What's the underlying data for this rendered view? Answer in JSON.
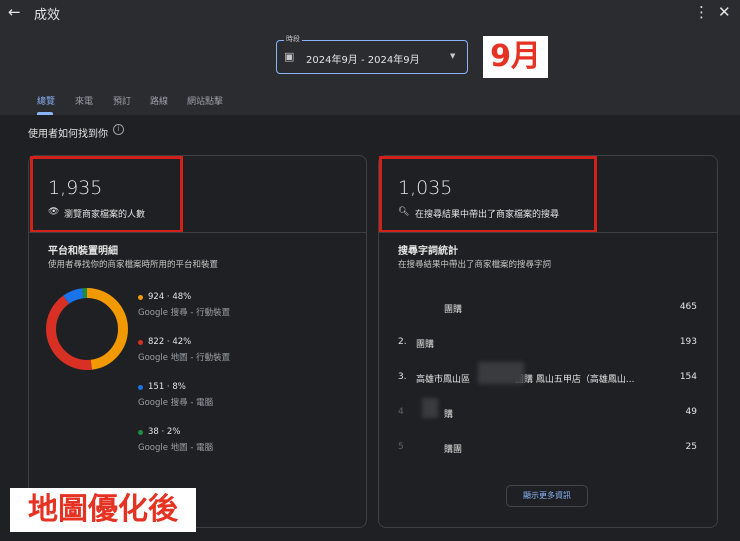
{
  "header": {
    "title": "成效",
    "back_icon": "arrow-left",
    "more_icon": "more-vert",
    "close_icon": "close"
  },
  "date": {
    "label": "時段",
    "value": "2024年9月 - 2024年9月"
  },
  "annotation_month": "9月",
  "annotation_after": "地圖優化後",
  "tabs": [
    {
      "label": "總覽",
      "active": true
    },
    {
      "label": "來電"
    },
    {
      "label": "預訂"
    },
    {
      "label": "路線"
    },
    {
      "label": "網站點擊"
    }
  ],
  "section_title": "使用者如何找到你",
  "left": {
    "count": "1,935",
    "count_label": "瀏覽商家檔案的人數",
    "title": "平台和裝置明細",
    "desc": "使用者尋找你的商家檔案時所用的平台和裝置",
    "legend": [
      {
        "value": "924 · 48%",
        "label": "Google 搜尋 - 行動裝置",
        "color": "#f29900",
        "pct": 48
      },
      {
        "value": "822 · 42%",
        "label": "Google 地圖 - 行動裝置",
        "color": "#d93025",
        "pct": 42
      },
      {
        "value": "151 · 8%",
        "label": "Google 搜尋 - 電腦",
        "color": "#1a73e8",
        "pct": 8
      },
      {
        "value": "38 · 2%",
        "label": "Google 地圖 - 電腦",
        "color": "#1e8e3e",
        "pct": 2
      }
    ]
  },
  "right": {
    "count": "1,035",
    "count_label": "在搜尋結果中帶出了商家檔案的搜尋",
    "title": "搜尋字詞統計",
    "desc": "在搜尋結果中帶出了商家檔案的搜尋字詞",
    "terms": [
      {
        "rank": "",
        "term": "團購",
        "count": "465"
      },
      {
        "rank": "2.",
        "term": "團購",
        "count": "193"
      },
      {
        "rank": "3.",
        "term": "高雄市鳳山區　　　　　團購 鳳山五甲店（高雄鳳山...",
        "count": "154"
      },
      {
        "rank": "4",
        "term": "購",
        "count": "49"
      },
      {
        "rank": "5",
        "term": "購團",
        "count": "25"
      }
    ],
    "more_button": "顯示更多資訊"
  }
}
